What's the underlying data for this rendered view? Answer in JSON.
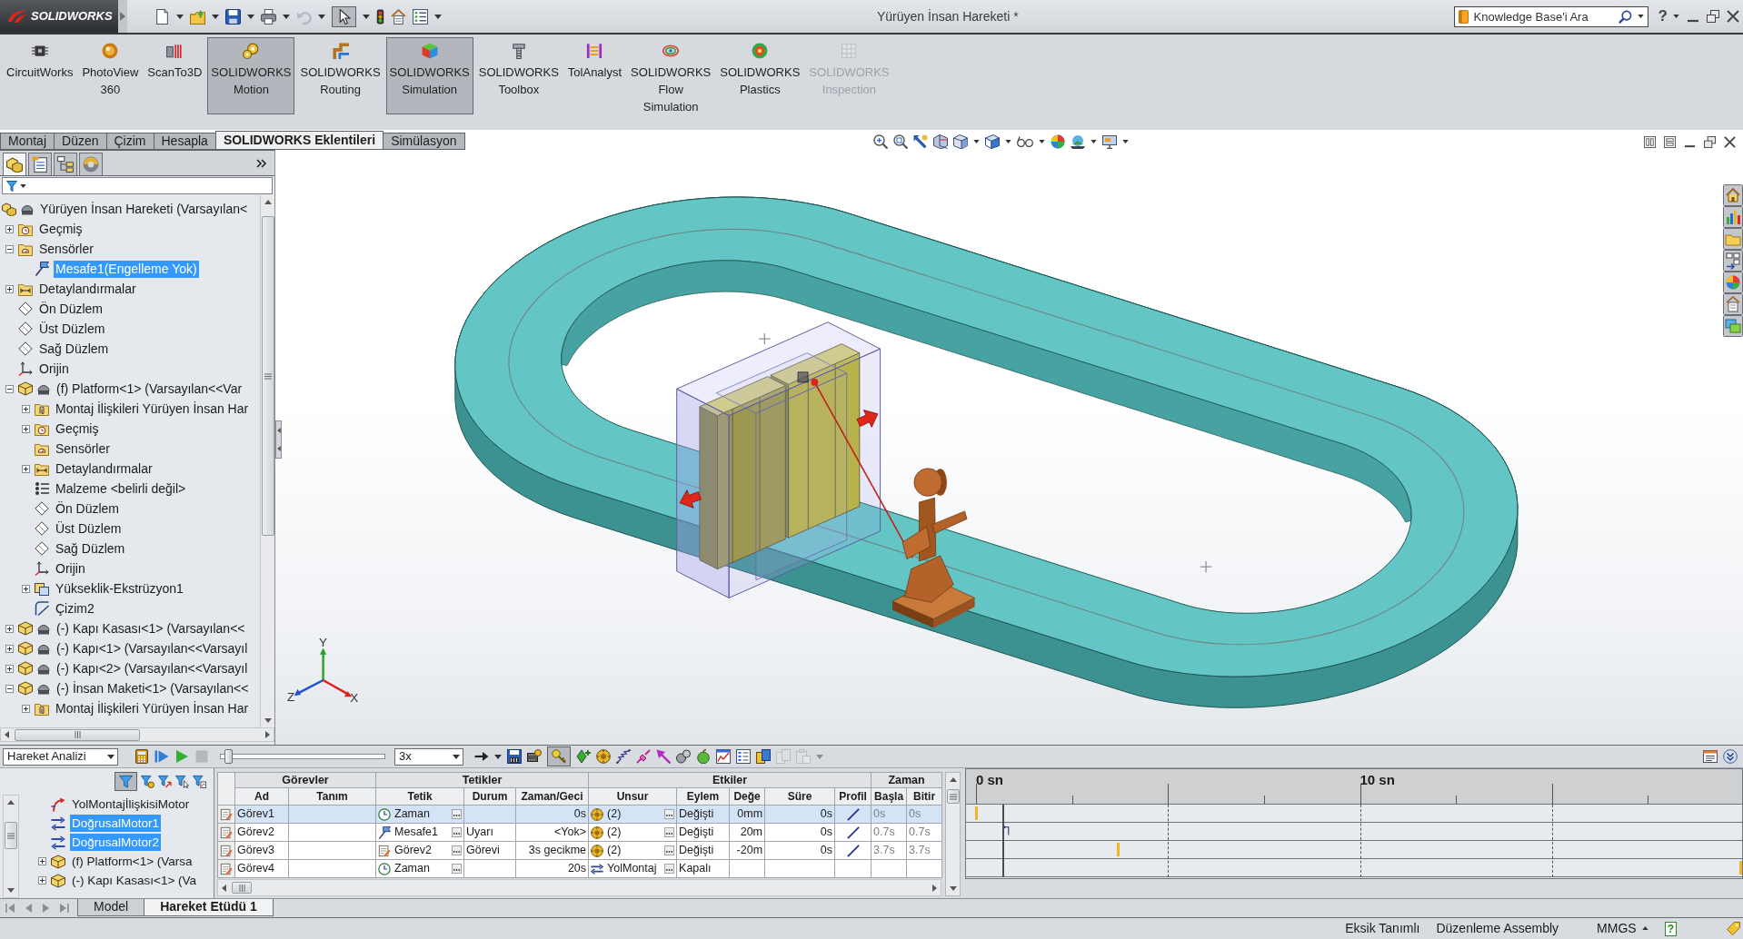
{
  "window": {
    "logo": "SOLIDWORKS",
    "title": "Yürüyen İnsan Hareketi *",
    "help": "?"
  },
  "quick_access": [
    {
      "kind": "new",
      "menu": true,
      "on": false,
      "disabled": false
    },
    {
      "kind": "open",
      "menu": true,
      "on": false,
      "disabled": false
    },
    {
      "kind": "save",
      "menu": true,
      "on": false,
      "disabled": false
    },
    {
      "kind": "print",
      "menu": true,
      "on": false,
      "disabled": false
    },
    {
      "kind": "undo",
      "menu": true,
      "on": false,
      "disabled": true
    },
    {
      "kind": "select",
      "menu": true,
      "on": true,
      "disabled": false
    },
    {
      "kind": "rebuild",
      "menu": false,
      "on": false,
      "disabled": false
    },
    {
      "kind": "file_properties",
      "menu": false,
      "on": false,
      "disabled": false
    },
    {
      "kind": "options",
      "menu": true,
      "on": false,
      "disabled": false
    }
  ],
  "search": {
    "placeholder": "Knowledge Base'i Ara"
  },
  "ribbon": {
    "items": [
      {
        "label": "CircuitWorks",
        "kind": "chip",
        "selected": false,
        "disabled": false
      },
      {
        "label": "PhotoView 360",
        "kind": "sphere",
        "selected": false,
        "disabled": false
      },
      {
        "label": "ScanTo3D",
        "kind": "scanner",
        "selected": false,
        "disabled": false
      },
      {
        "label": "SOLIDWORKS Motion",
        "kind": "motion",
        "selected": true,
        "disabled": false
      },
      {
        "label": "SOLIDWORKS Routing",
        "kind": "routing",
        "selected": false,
        "disabled": false
      },
      {
        "label": "SOLIDWORKS Simulation",
        "kind": "simulation",
        "selected": true,
        "disabled": false
      },
      {
        "label": "SOLIDWORKS Toolbox",
        "kind": "toolbox",
        "selected": false,
        "disabled": false
      },
      {
        "label": "TolAnalyst",
        "kind": "tolanalyst",
        "selected": false,
        "disabled": false
      },
      {
        "label": "SOLIDWORKS Flow Simulation",
        "kind": "flow",
        "selected": false,
        "disabled": false
      },
      {
        "label": "SOLIDWORKS Plastics",
        "kind": "plastics",
        "selected": false,
        "disabled": false
      },
      {
        "label": "SOLIDWORKS Inspection",
        "kind": "inspection",
        "selected": false,
        "disabled": true
      }
    ]
  },
  "command_tabs": [
    {
      "label": "Montaj",
      "selected": false
    },
    {
      "label": "Düzen",
      "selected": false
    },
    {
      "label": "Çizim",
      "selected": false
    },
    {
      "label": "Hesapla",
      "selected": false
    },
    {
      "label": "SOLIDWORKS Eklentileri",
      "selected": true
    },
    {
      "label": "Simülasyon",
      "selected": false
    }
  ],
  "feature_manager": {
    "tabs": [
      {
        "kind": "features",
        "selected": true
      },
      {
        "kind": "properties",
        "selected": false
      },
      {
        "kind": "configurations",
        "selected": false
      },
      {
        "kind": "display",
        "selected": false
      }
    ],
    "tree": [
      {
        "label": "Yürüyen İnsan Hareketi (Varsayılan<",
        "kind": "assembly",
        "selected": false,
        "children": [
          {
            "label": "Geçmiş",
            "kind": "history",
            "selected": false,
            "expanded": false
          },
          {
            "label": "Sensörler",
            "kind": "sensors",
            "selected": false,
            "expanded": true,
            "children": [
              {
                "label": "Mesafe1(Engelleme Yok)",
                "kind": "sensor",
                "selected": true
              }
            ]
          },
          {
            "label": "Detaylandırmalar",
            "kind": "annotations",
            "selected": false,
            "expanded": false
          },
          {
            "label": "Ön Düzlem",
            "kind": "plane",
            "selected": false
          },
          {
            "label": "Üst Düzlem",
            "kind": "plane",
            "selected": false
          },
          {
            "label": "Sağ Düzlem",
            "kind": "plane",
            "selected": false
          },
          {
            "label": "Orijin",
            "kind": "origin",
            "selected": false
          },
          {
            "label": "(f) Platform<1> (Varsayılan<<Var",
            "kind": "part",
            "selected": false,
            "expanded": true,
            "children": [
              {
                "label": "Montaj İlişkileri Yürüyen İnsan Har",
                "kind": "mates",
                "selected": false,
                "expanded": false
              },
              {
                "label": "Geçmiş",
                "kind": "history",
                "selected": false,
                "expanded": false
              },
              {
                "label": "Sensörler",
                "kind": "sensors",
                "selected": false
              },
              {
                "label": "Detaylandırmalar",
                "kind": "annotations",
                "selected": false,
                "expanded": false
              },
              {
                "label": "Malzeme <belirli değil>",
                "kind": "material",
                "selected": false
              },
              {
                "label": "Ön Düzlem",
                "kind": "plane",
                "selected": false
              },
              {
                "label": "Üst Düzlem",
                "kind": "plane",
                "selected": false
              },
              {
                "label": "Sağ Düzlem",
                "kind": "plane",
                "selected": false
              },
              {
                "label": "Orijin",
                "kind": "origin",
                "selected": false
              },
              {
                "label": "Yükseklik-Ekstrüzyon1",
                "kind": "extrude",
                "selected": false,
                "expanded": false
              },
              {
                "label": "Çizim2",
                "kind": "sketch",
                "selected": false
              }
            ]
          },
          {
            "label": "(-) Kapı Kasası<1> (Varsayılan<<",
            "kind": "part",
            "selected": false,
            "expanded": false
          },
          {
            "label": "(-) Kapı<1> (Varsayılan<<Varsayıl",
            "kind": "part",
            "selected": false,
            "expanded": false
          },
          {
            "label": "(-) Kapı<2> (Varsayılan<<Varsayıl",
            "kind": "part",
            "selected": false,
            "expanded": false
          },
          {
            "label": "(-) İnsan Maketi<1> (Varsayılan<<",
            "kind": "part",
            "selected": false,
            "expanded": true,
            "children": [
              {
                "label": "Montaj İlişkileri Yürüyen İnsan Har",
                "kind": "mates",
                "selected": false,
                "expanded": false
              }
            ]
          }
        ]
      }
    ]
  },
  "viewport": {
    "triad": [
      {
        "label": "Y",
        "color": "#2ca02c"
      },
      {
        "label": "Z",
        "color": "#2050d0"
      },
      {
        "label": "X",
        "color": "#e02020"
      }
    ]
  },
  "motion_study": {
    "toolbar": {
      "study_type": "Hareket Analizi",
      "playback": [
        {
          "kind": "calculate",
          "disabled": false
        },
        {
          "kind": "play_from_start",
          "disabled": false
        },
        {
          "kind": "play",
          "disabled": false
        },
        {
          "kind": "stop",
          "disabled": true
        }
      ],
      "time_slider": {
        "level": 0.03
      },
      "playback_speed": "3x",
      "tools": [
        {
          "kind": "playback_mode",
          "menu": true,
          "on": false,
          "disabled": false
        },
        {
          "kind": "save_animation",
          "menu": false,
          "on": false,
          "disabled": false
        },
        {
          "kind": "animation_wizard",
          "menu": false,
          "on": false,
          "disabled": false
        },
        {
          "kind": "autokey",
          "menu": false,
          "on": true,
          "disabled": false
        },
        {
          "kind": "add_key",
          "menu": false,
          "on": false,
          "disabled": false
        },
        {
          "kind": "motor",
          "menu": false,
          "on": false,
          "disabled": false
        },
        {
          "kind": "spring",
          "menu": false,
          "on": false,
          "disabled": false
        },
        {
          "kind": "damper",
          "menu": false,
          "on": false,
          "disabled": false
        },
        {
          "kind": "force",
          "menu": false,
          "on": false,
          "disabled": false
        },
        {
          "kind": "contact",
          "menu": false,
          "on": false,
          "disabled": false
        },
        {
          "kind": "gravity",
          "menu": false,
          "on": false,
          "disabled": false
        },
        {
          "kind": "results",
          "menu": false,
          "on": false,
          "disabled": false
        },
        {
          "kind": "study_properties",
          "menu": false,
          "on": false,
          "disabled": false
        },
        {
          "kind": "tile_view",
          "menu": false,
          "on": false,
          "disabled": false
        },
        {
          "kind": "copy_layout",
          "menu": false,
          "on": false,
          "disabled": true
        },
        {
          "kind": "paste_layout",
          "menu": true,
          "on": false,
          "disabled": true
        }
      ]
    },
    "filters": [
      {
        "kind": "funnel",
        "on": true
      },
      {
        "kind": "funnel_gear",
        "on": false
      },
      {
        "kind": "funnel_arrow",
        "on": false
      },
      {
        "kind": "funnel_pointer",
        "on": false
      },
      {
        "kind": "funnel_chart",
        "on": false
      }
    ],
    "tree": [
      {
        "label": "YolMontajİlişkisiMotor",
        "kind": "mate_motor",
        "selected": false
      },
      {
        "label": "DoğrusalMotor1",
        "kind": "linear_motor",
        "selected": true
      },
      {
        "label": "DoğrusalMotor2",
        "kind": "linear_motor",
        "selected": true
      },
      {
        "label": "(f) Platform<1> (Varsa",
        "kind": "component",
        "selected": false,
        "expanded": false
      },
      {
        "label": "(-) Kapı Kasası<1> (Va",
        "kind": "component",
        "selected": false,
        "expanded": false
      }
    ],
    "tasks": {
      "groups": [
        {
          "label": "Görevler",
          "columns": [
            "Ad",
            "Tanım"
          ]
        },
        {
          "label": "Tetikler",
          "columns": [
            "Tetik",
            "Durum",
            "Zaman/Geci"
          ]
        },
        {
          "label": "Etkiler",
          "columns": [
            "Unsur",
            "Eylem",
            "Değe",
            "Süre",
            "Profil"
          ]
        },
        {
          "label": "Zaman",
          "columns": [
            "Başla",
            "Bitir"
          ]
        }
      ],
      "rows": [
        {
          "selected": true,
          "name": "Görev1",
          "trigger": {
            "text": "Zaman",
            "kind": "time"
          },
          "time_delay": "0s",
          "feature": {
            "text": "(2)",
            "kind": "motors"
          },
          "action": "Değişti",
          "value": "0mm",
          "duration": "0s",
          "profile": {
            "kind": "linear"
          },
          "start": "0s",
          "end": "0s"
        },
        {
          "selected": false,
          "name": "Görev2",
          "trigger": {
            "text": "Mesafe1",
            "kind": "sensor"
          },
          "condition": "Uyarı",
          "time_delay": "<Yok>",
          "feature": {
            "text": "(2)",
            "kind": "motors"
          },
          "action": "Değişti",
          "value": "20m",
          "duration": "0s",
          "profile": {
            "kind": "linear"
          },
          "start": "0.7s",
          "end": "0.7s"
        },
        {
          "selected": false,
          "name": "Görev3",
          "trigger": {
            "text": "Görev2",
            "kind": "task"
          },
          "condition": "Görevi",
          "time_delay": "3s gecikme",
          "feature": {
            "text": "(2)",
            "kind": "motors"
          },
          "action": "Değişti",
          "value": "-20m",
          "duration": "0s",
          "profile": {
            "kind": "linear"
          },
          "start": "3.7s",
          "end": "3.7s"
        },
        {
          "selected": false,
          "name": "Görev4",
          "trigger": {
            "text": "Zaman",
            "kind": "time"
          },
          "time_delay": "20s",
          "feature": {
            "text": "YolMontaj",
            "kind": "mate"
          },
          "action": "Kapalı"
        }
      ]
    },
    "timeline": {
      "labels": [
        "0 sn",
        "10 sn"
      ],
      "time_bar": {
        "level": 0.035
      },
      "rows": [
        {
          "markers": [
            {
              "kind": "key",
              "level": 0
            }
          ]
        },
        {
          "markers": [
            {
              "kind": "step",
              "level": 0.035
            }
          ]
        },
        {
          "markers": [
            {
              "kind": "key",
              "level": 0.185
            }
          ]
        },
        {
          "markers": [
            {
              "kind": "key",
              "level": 1
            }
          ]
        }
      ]
    },
    "tabs": [
      {
        "label": "Model",
        "selected": false
      },
      {
        "label": "Hareket Etüdü 1",
        "selected": true
      }
    ]
  },
  "status_bar": {
    "texts": [
      "Eksik Tanımlı",
      "Düzenleme Assembly"
    ],
    "units": "MMGS",
    "help": "?"
  }
}
